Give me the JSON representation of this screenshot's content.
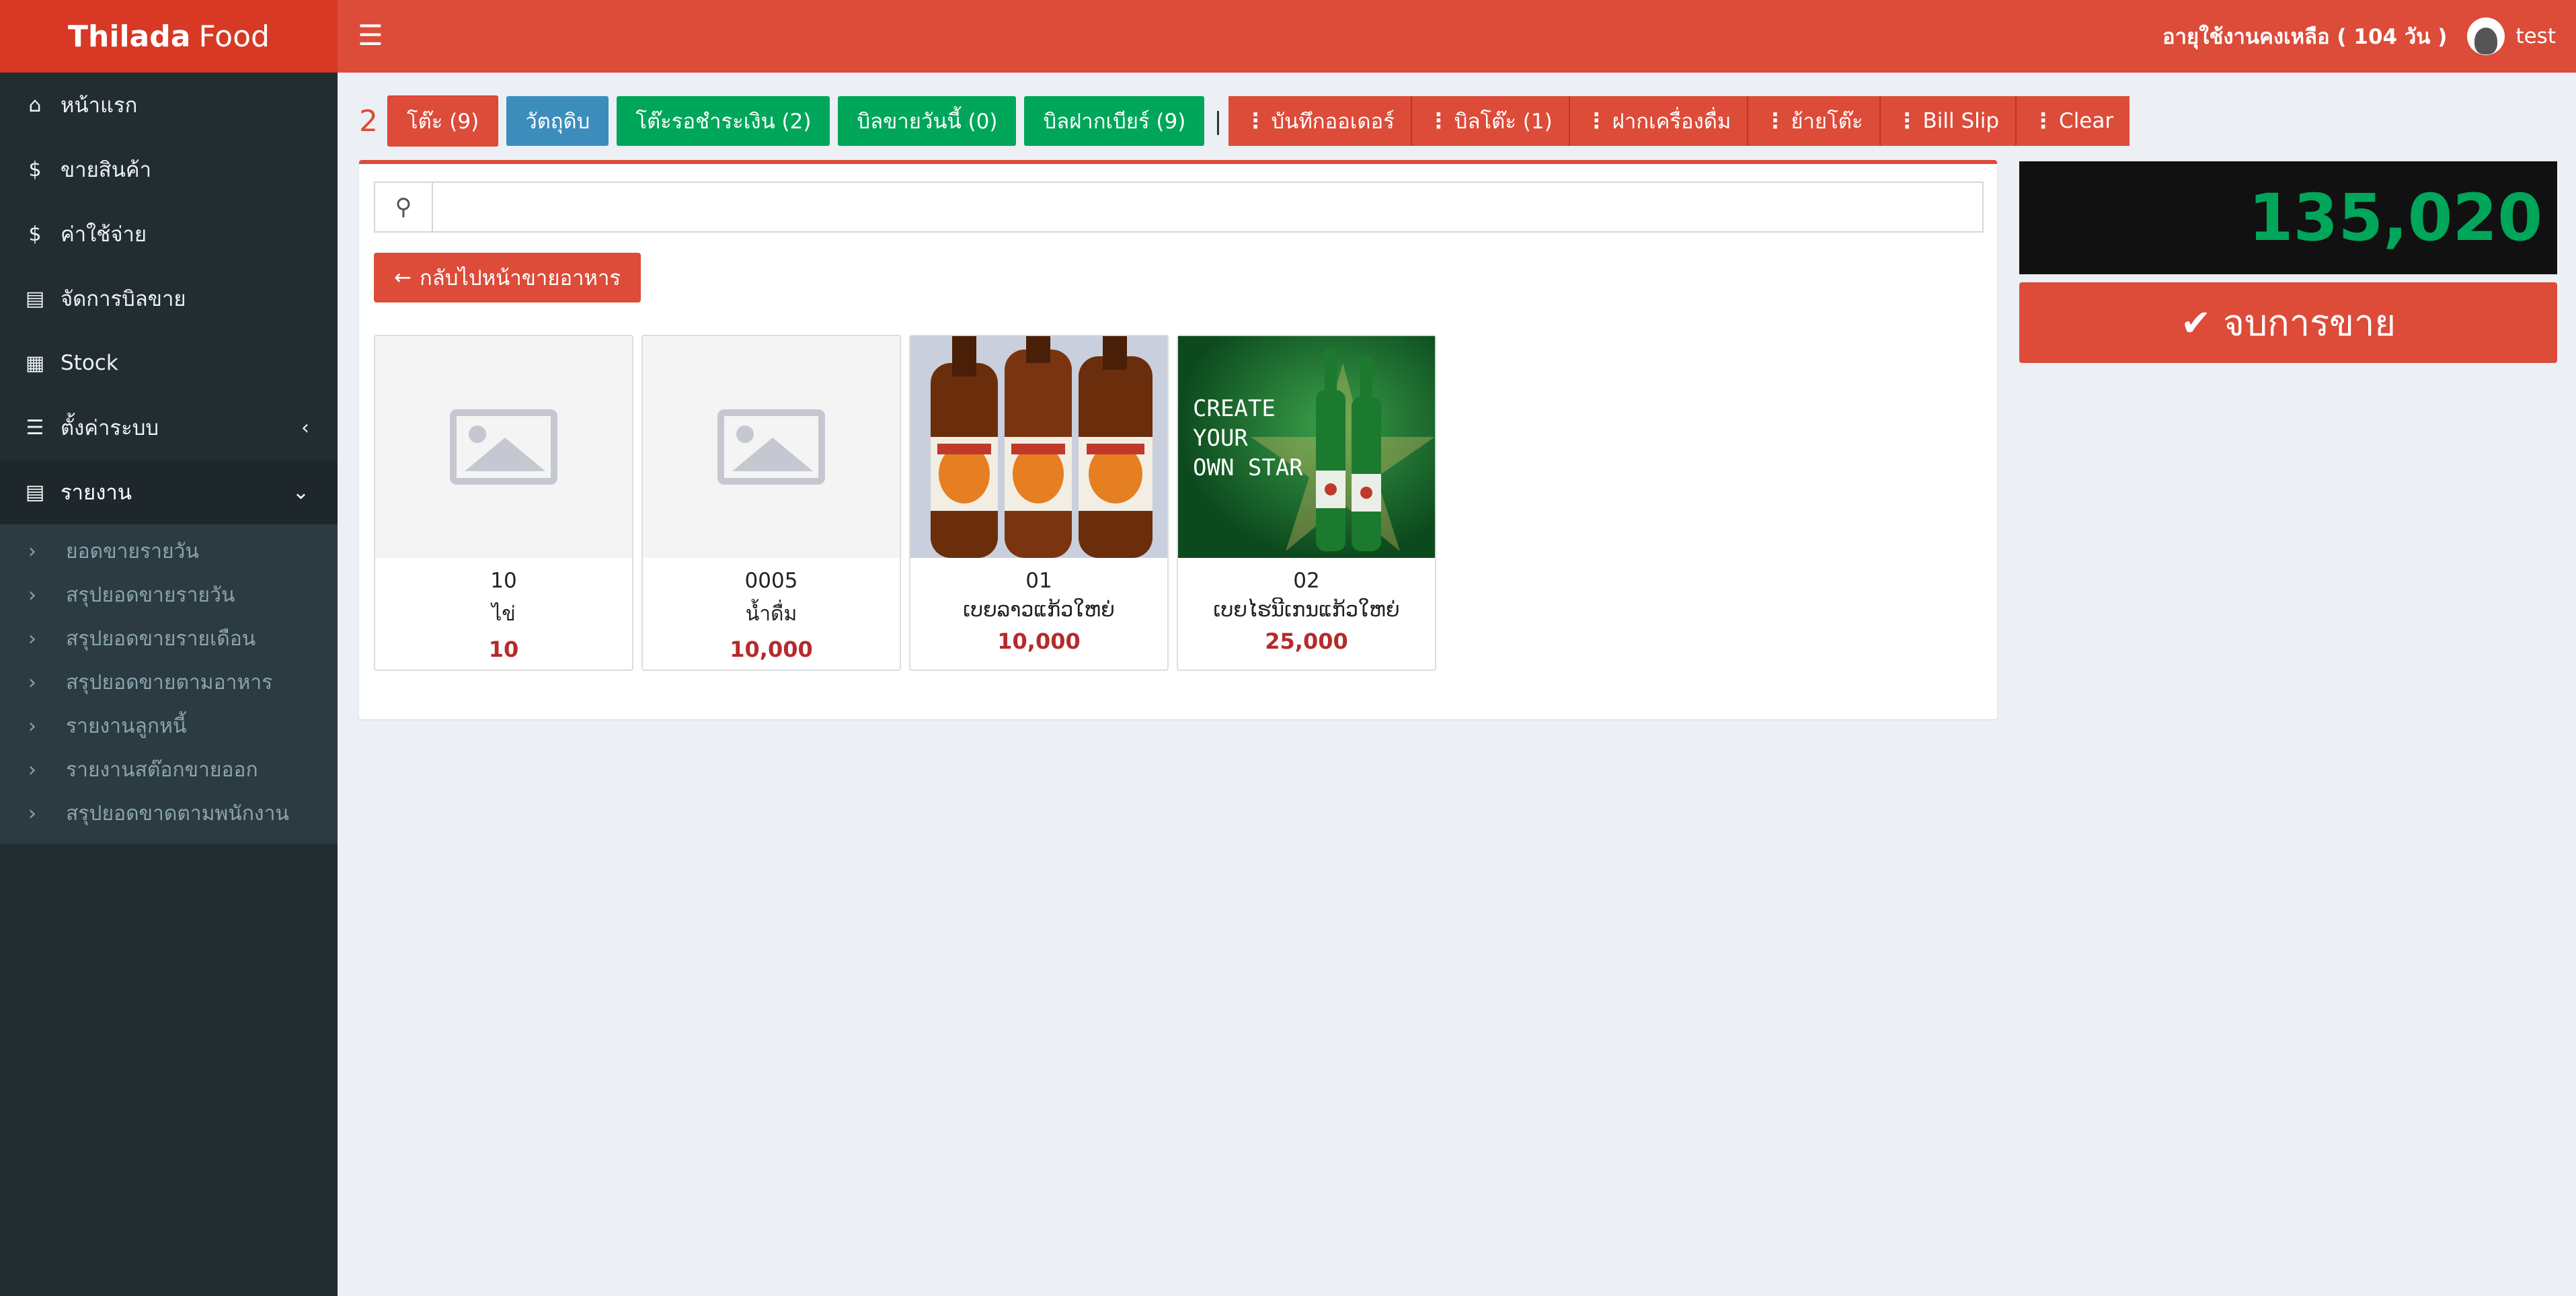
{
  "brand": {
    "bold": "Thilada",
    "rest": "Food"
  },
  "header": {
    "remaining": "อายุใช้งานคงเหลือ ( 104 วัน )",
    "username": "test"
  },
  "sidebar": {
    "items": [
      {
        "label": "หน้าแรก",
        "icon": "home-icon"
      },
      {
        "label": "ขายสินค้า",
        "icon": "dollar-icon"
      },
      {
        "label": "ค่าใช้จ่าย",
        "icon": "dollar-icon"
      },
      {
        "label": "จัดการบิลขาย",
        "icon": "file-icon"
      },
      {
        "label": "Stock",
        "icon": "table-icon"
      },
      {
        "label": "ตั้งค่าระบบ",
        "icon": "list-icon"
      },
      {
        "label": "รายงาน",
        "icon": "file-icon"
      }
    ],
    "report_sub": [
      "ยอดขายรายวัน",
      "สรุปยอดขายรายวัน",
      "สรุปยอดขายรายเดือน",
      "สรุปยอดขายตามอาหาร",
      "รายงานลูกหนี้",
      "รายงานสต๊อกขายออก",
      "สรุปยอดขาดตามพนักงาน"
    ]
  },
  "toolbar": {
    "table_number": "2",
    "tables": "โต๊ะ (9)",
    "ingredients": "วัตถุดิบ",
    "waiting_pay": "โต๊ะรอชำระเงิน (2)",
    "today_bills": "บิลขายวันนี้ (0)",
    "beer_bills": "บิลฝากเบียร์ (9)",
    "separator": "|",
    "save_order": "บันทึกออเดอร์",
    "table_bill": "บิลโต๊ะ (1)",
    "deposit_drink": "ฝากเครื่องดื่ม",
    "move_table": "ย้ายโต๊ะ",
    "bill_slip": "Bill Slip",
    "clear": "Clear"
  },
  "search": {
    "placeholder": ""
  },
  "back_button": "กลับไปหน้าขายอาหาร",
  "products": [
    {
      "code": "10",
      "name": "ไข่",
      "price": "10",
      "image": "placeholder"
    },
    {
      "code": "0005",
      "name": "น้ำดื่ม",
      "price": "10,000",
      "image": "placeholder"
    },
    {
      "code": "01",
      "name": "ເບຍລາວແກ້ວໃຫຍ່",
      "price": "10,000",
      "image": "beerlao-photo"
    },
    {
      "code": "02",
      "name": "ເບຍໄຮນີເກນແກ້ວໃຫຍ່",
      "price": "25,000",
      "image": "heineken-photo"
    }
  ],
  "heineken_ad": {
    "line1": "CREATE",
    "line2": "YOUR",
    "line3": "OWN STAR"
  },
  "total": "135,020",
  "finish_button": "จบการขาย",
  "colors": {
    "header": "#dd4b39",
    "sidebar": "#222d32",
    "green": "#00a65a",
    "blue": "#3c8dbc"
  }
}
